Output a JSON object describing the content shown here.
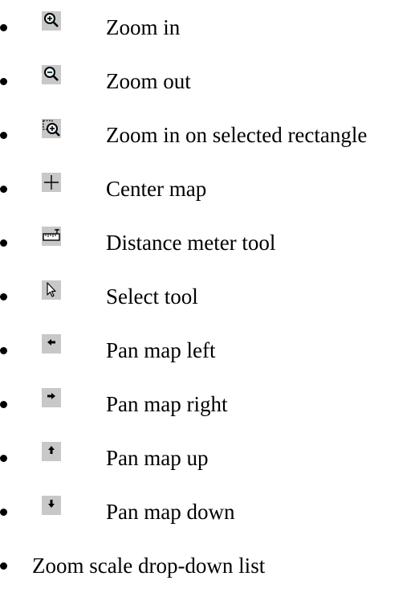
{
  "items": [
    {
      "label": "Zoom in",
      "icon": "zoom-in-icon"
    },
    {
      "label": "Zoom out",
      "icon": "zoom-out-icon"
    },
    {
      "label": "Zoom in on selected rectangle",
      "icon": "zoom-rectangle-icon"
    },
    {
      "label": "Center map",
      "icon": "crosshair-icon"
    },
    {
      "label": "Distance meter tool",
      "icon": "ruler-icon"
    },
    {
      "label": "Select tool",
      "icon": "pointer-arrow-icon"
    },
    {
      "label": "Pan map left",
      "icon": "arrow-left-icon"
    },
    {
      "label": "Pan map right",
      "icon": "arrow-right-icon"
    },
    {
      "label": "Pan map up",
      "icon": "arrow-up-icon"
    },
    {
      "label": "Pan map down",
      "icon": "arrow-down-icon"
    },
    {
      "label": "Zoom scale drop-down list",
      "icon": ""
    }
  ],
  "colors": {
    "icon_bg": "#c8c8c8",
    "glass_fill": "#e8f4ff",
    "icon_stroke": "#000000",
    "text": "#000000"
  }
}
